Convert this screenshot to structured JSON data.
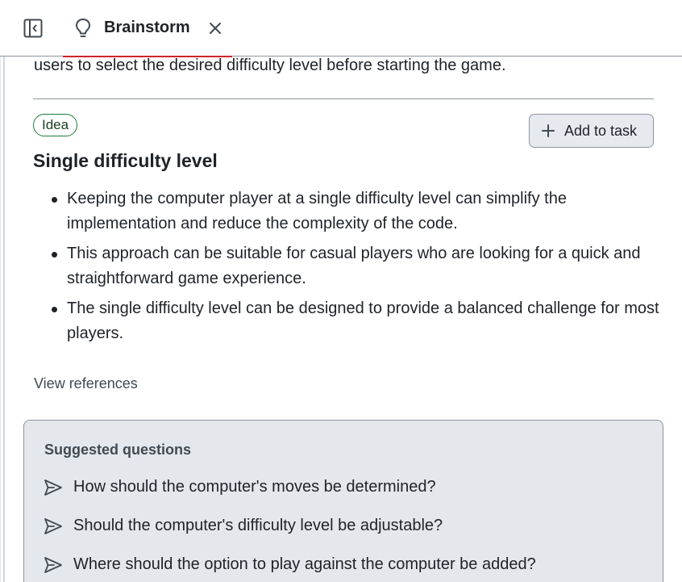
{
  "header": {
    "tab_label": "Brainstorm"
  },
  "content": {
    "previous_text": "users to select the desired difficulty level before starting the game."
  },
  "idea": {
    "badge": "Idea",
    "add_to_task_label": "Add to task",
    "title": "Single difficulty level",
    "bullets": [
      "Keeping the computer player at a single difficulty level can simplify the implementation and reduce the complexity of the code.",
      "This approach can be suitable for casual players who are looking for a quick and straightforward game experience.",
      "The single difficulty level can be designed to provide a balanced challenge for most players."
    ],
    "view_references": "View references"
  },
  "suggested": {
    "title": "Suggested questions",
    "questions": [
      "How should the computer's moves be determined?",
      "Should the computer's difficulty level be adjustable?",
      "Where should the option to play against the computer be added?"
    ]
  },
  "colors": {
    "tab_underline": "#cf222e",
    "badge_border": "#1a7f37",
    "suggested_bg": "#e4e8ec",
    "button_bg": "#e6eaef"
  },
  "icons": {
    "panel_toggle": "sidebar-toggle-icon",
    "tab": "lightbulb-icon",
    "close": "close-icon",
    "add": "plus-icon",
    "question": "send-icon"
  }
}
